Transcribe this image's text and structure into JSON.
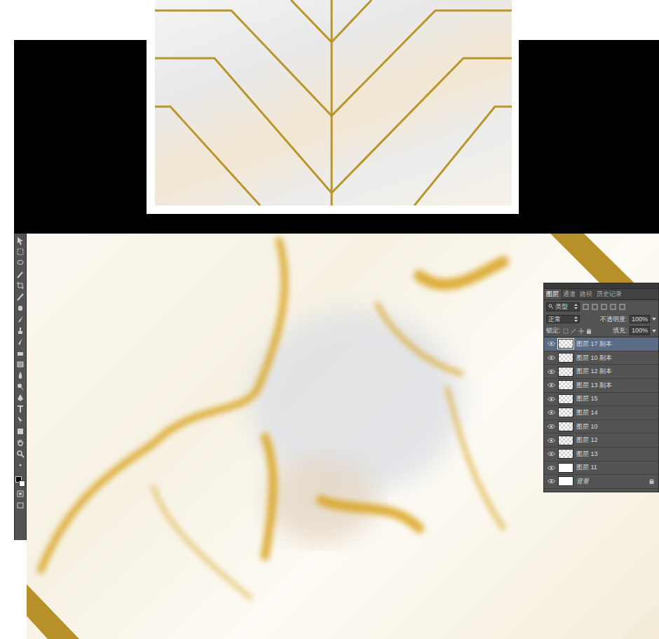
{
  "panel": {
    "tabs": [
      {
        "label": "图层",
        "selected": true
      },
      {
        "label": "通道",
        "selected": false
      },
      {
        "label": "路径",
        "selected": false
      },
      {
        "label": "历史记录",
        "selected": false
      }
    ],
    "filter": "类型",
    "blend_mode": "正常",
    "opacity_label": "不透明度:",
    "opacity": "100%",
    "lock_label": "锁定:",
    "fill_label": "填充:",
    "fill": "100%",
    "layers": [
      {
        "name": "图层 17 副本",
        "selected": true,
        "visible": true,
        "locked": false,
        "kind": "transparent"
      },
      {
        "name": "图层 10 副本",
        "selected": false,
        "visible": true,
        "locked": false,
        "kind": "transparent"
      },
      {
        "name": "图层 12 副本",
        "selected": false,
        "visible": true,
        "locked": false,
        "kind": "transparent"
      },
      {
        "name": "图层 13 副本",
        "selected": false,
        "visible": true,
        "locked": false,
        "kind": "transparent"
      },
      {
        "name": "图层 15",
        "selected": false,
        "visible": true,
        "locked": false,
        "kind": "transparent"
      },
      {
        "name": "图层 14",
        "selected": false,
        "visible": true,
        "locked": false,
        "kind": "transparent"
      },
      {
        "name": "图层 10",
        "selected": false,
        "visible": true,
        "locked": false,
        "kind": "transparent"
      },
      {
        "name": "图层 12",
        "selected": false,
        "visible": true,
        "locked": false,
        "kind": "transparent"
      },
      {
        "name": "图层 13",
        "selected": false,
        "visible": true,
        "locked": false,
        "kind": "transparent"
      },
      {
        "name": "图层 11",
        "selected": false,
        "visible": true,
        "locked": false,
        "kind": "white"
      },
      {
        "name": "背景",
        "selected": false,
        "visible": true,
        "locked": true,
        "kind": "white"
      }
    ]
  }
}
